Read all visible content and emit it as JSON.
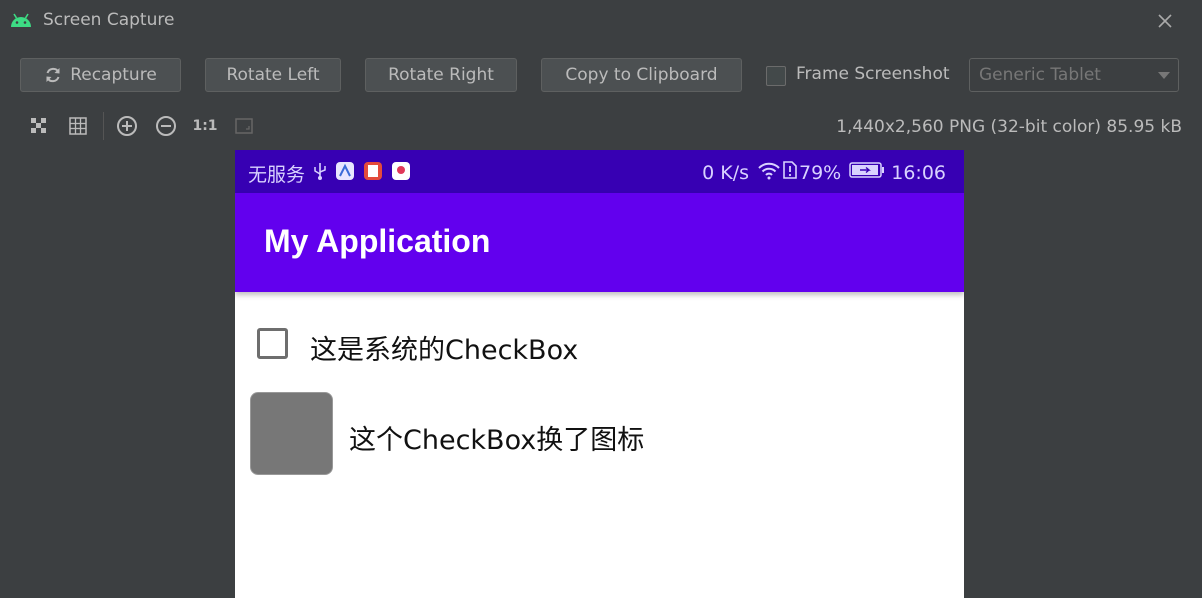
{
  "window": {
    "title": "Screen Capture",
    "app_icon": "android-icon",
    "close_icon": "close-icon"
  },
  "toolbar": {
    "recapture_label": "Recapture",
    "rotate_left_label": "Rotate Left",
    "rotate_right_label": "Rotate Right",
    "copy_label": "Copy to Clipboard",
    "frame_screenshot_label": "Frame Screenshot",
    "frame_screenshot_checked": false,
    "device_selected": "Generic Tablet"
  },
  "view_tools": {
    "actual_size_label": "1:1",
    "image_info": "1,440x2,560 PNG (32-bit color) 85.95 kB"
  },
  "phone": {
    "status_bar": {
      "left_text": "无服务",
      "speed": "0 K/s",
      "battery": "79%",
      "time": "16:06"
    },
    "app_bar_title": "My Application",
    "checkbox1_label": "这是系统的CheckBox",
    "checkbox2_label": "这个CheckBox换了图标"
  },
  "colors": {
    "status_bar": "#3700b3",
    "app_bar": "#6200ee",
    "android_green": "#3ddc84"
  }
}
